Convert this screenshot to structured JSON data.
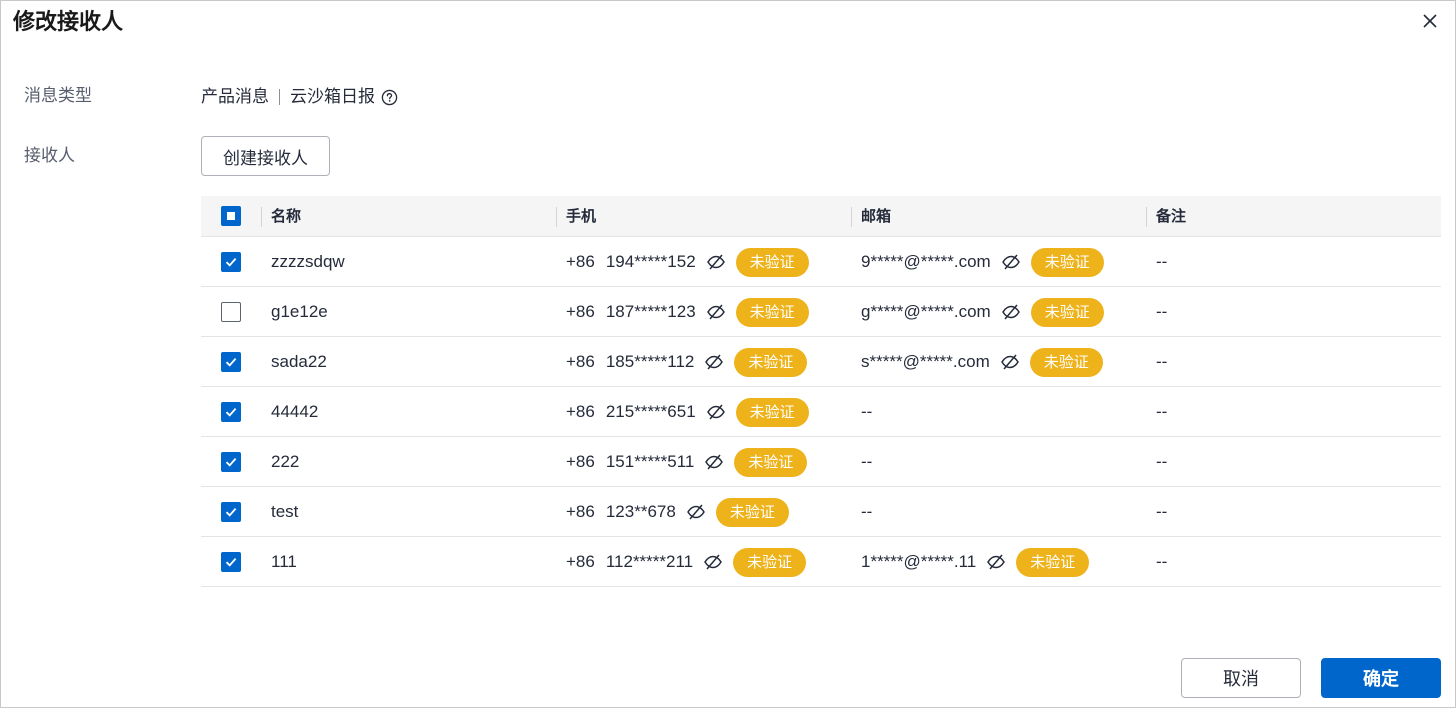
{
  "dialog": {
    "title": "修改接收人"
  },
  "form": {
    "msg_type_label": "消息类型",
    "msg_type_part1": "产品消息",
    "msg_type_part2": "云沙箱日报",
    "recipient_label": "接收人",
    "create_btn": "创建接收人"
  },
  "table": {
    "headers": {
      "name": "名称",
      "phone": "手机",
      "email": "邮箱",
      "remark": "备注"
    },
    "rows": [
      {
        "checked": true,
        "name": "zzzzsdqw",
        "code": "+86",
        "phone": "194*****152",
        "phone_badge": "未验证",
        "email": "9*****@*****.com",
        "email_badge": "未验证",
        "remark": "--"
      },
      {
        "checked": false,
        "name": "g1e12e",
        "code": "+86",
        "phone": "187*****123",
        "phone_badge": "未验证",
        "email": "g*****@*****.com",
        "email_badge": "未验证",
        "remark": "--"
      },
      {
        "checked": true,
        "name": "sada22",
        "code": "+86",
        "phone": "185*****112",
        "phone_badge": "未验证",
        "email": "s*****@*****.com",
        "email_badge": "未验证",
        "remark": "--"
      },
      {
        "checked": true,
        "name": "44442",
        "code": "+86",
        "phone": "215*****651",
        "phone_badge": "未验证",
        "email": "--",
        "email_badge": "",
        "remark": "--"
      },
      {
        "checked": true,
        "name": "222",
        "code": "+86",
        "phone": "151*****511",
        "phone_badge": "未验证",
        "email": "--",
        "email_badge": "",
        "remark": "--"
      },
      {
        "checked": true,
        "name": "test",
        "code": "+86",
        "phone": "123**678",
        "phone_badge": "未验证",
        "email": "--",
        "email_badge": "",
        "remark": "--"
      },
      {
        "checked": true,
        "name": "111",
        "code": "+86",
        "phone": "112*****211",
        "phone_badge": "未验证",
        "email": "1*****@*****.11",
        "email_badge": "未验证",
        "remark": "--"
      }
    ]
  },
  "footer": {
    "cancel": "取消",
    "ok": "确定"
  },
  "colors": {
    "primary": "#0066cc",
    "badge": "#eeb31b"
  }
}
